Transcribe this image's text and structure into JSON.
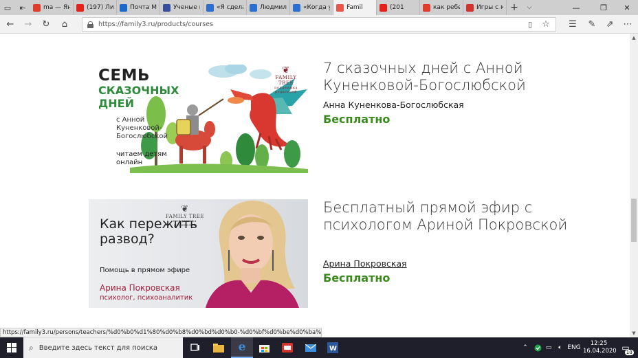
{
  "browser": {
    "tabs": [
      {
        "label": "ma — Ян",
        "icon": "yandex-icon",
        "color": "#e03e2d"
      },
      {
        "label": "(197) Лин",
        "icon": "youtube-icon",
        "color": "#e62117"
      },
      {
        "label": "Почта М",
        "icon": "mail-icon",
        "color": "#1b6ac9"
      },
      {
        "label": "Ученые г",
        "icon": "page-icon",
        "color": "#3a4f9c"
      },
      {
        "label": "«Я сдела",
        "icon": "family-tree-icon",
        "color": "#2d6fd1"
      },
      {
        "label": "Людмил",
        "icon": "family-tree-icon",
        "color": "#2d6fd1"
      },
      {
        "label": "«Когда у",
        "icon": "family-tree-icon",
        "color": "#2d6fd1"
      },
      {
        "label": "Famil",
        "icon": "family-icon",
        "color": "#e8574a",
        "active": true
      },
      {
        "label": "(201",
        "icon": "youtube-icon",
        "color": "#e62117"
      },
      {
        "label": "как ребе",
        "icon": "yandex-icon",
        "color": "#e03e2d"
      },
      {
        "label": "Игры с м",
        "icon": "alert-icon",
        "color": "#d0342c"
      }
    ],
    "url": "https://family3.ru/products/courses"
  },
  "courses": [
    {
      "title": "7 сказочных дней с Анной Куненковой-Богослюбской",
      "author": "Анна Куненкова-Богослюбская",
      "price": "Бесплатно",
      "image": {
        "headline": "СЕМЬ",
        "headline_colored": "СКАЗОЧНЫХ ДНЕЙ",
        "subtitle": "с Анной Куненковой-Богослюбской",
        "tagline": "читаем детям онлайн",
        "brand": "FAMILY TREE",
        "brand_sub": "поддержка родителей"
      }
    },
    {
      "title": "Бесплатный прямой эфир с психологом Ариной Покровской",
      "author": "Арина Покровская",
      "price": "Бесплатно",
      "image": {
        "headline": "Как пережить развод?",
        "subtitle": "Помощь в прямом эфире",
        "name": "Арина Покровская",
        "role": "психолог, психоаналитик",
        "brand": "FAMILY TREE",
        "brand_sub": "поддержка родителей"
      }
    }
  ],
  "status_url": "https://family3.ru/persons/teachers/%d0%b0%d1%80%d0%b8%d0%bd%d0%b0-%d0%bf%d0%be%d0%ba%d1%80%d0%be%d0%b2",
  "taskbar": {
    "search_placeholder": "Введите здесь текст для поиска",
    "lang": "ENG",
    "time": "12:25",
    "date": "16.04.2020",
    "notifications": "10"
  }
}
